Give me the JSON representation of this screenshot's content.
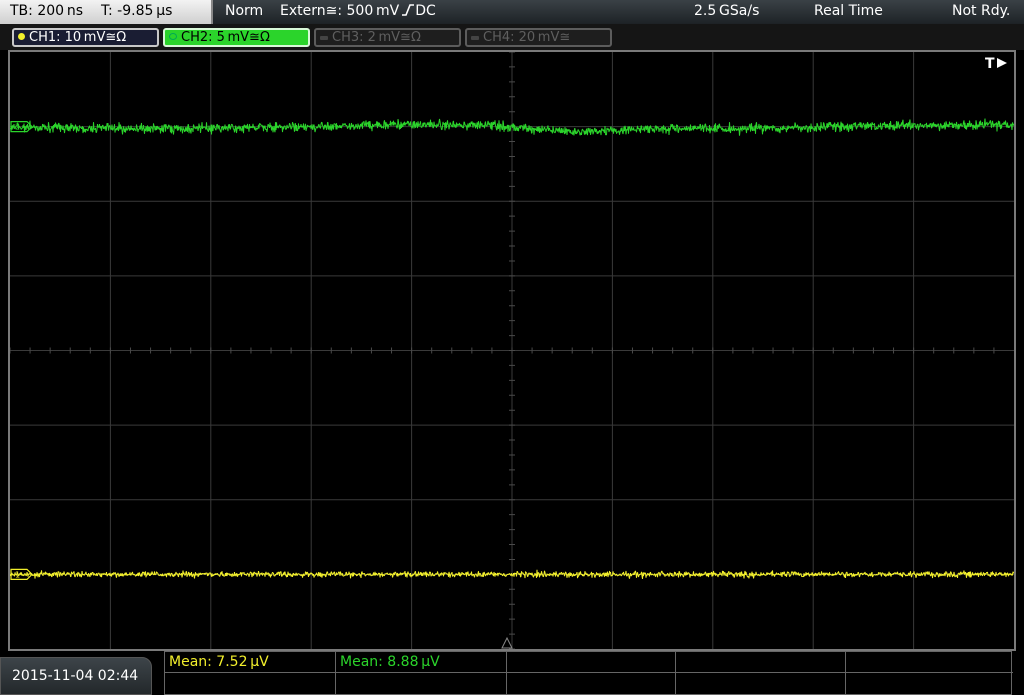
{
  "topbar": {
    "timebase": "TB: 200 ns",
    "trigger_time": "T: -9.85 µs",
    "acq_mode": "Norm",
    "trigger_source": "Extern≅: 500 mV",
    "trigger_coupling": "DC",
    "sample_rate": "2.5 GSa/s",
    "mode": "Real Time",
    "status": "Not Rdy."
  },
  "channels": [
    {
      "label": "CH1: 10 mV≅Ω",
      "color": "#f2ef2c",
      "state": "active"
    },
    {
      "label": "CH2: 5 mV≅Ω",
      "color": "#2bd42b",
      "state": "selected"
    },
    {
      "label": "CH3: 2 mV≅Ω",
      "color": "#5f5f5f",
      "state": "off"
    },
    {
      "label": "CH4: 20 mV≅",
      "color": "#5f5f5f",
      "state": "off"
    }
  ],
  "screen": {
    "trigger_marker": "T",
    "ch1_marker": "1",
    "ch2_marker": "2",
    "ch1_level_div": -3.0,
    "ch2_level_div": 3.0,
    "grid_divisions": {
      "x": 10,
      "y": 8
    },
    "trace_colors": {
      "ch1": "#f2ef2c",
      "ch2": "#2bd42b"
    }
  },
  "bottom": {
    "datetime": "2015-11-04 02:44",
    "measurements": [
      {
        "text": "Mean: 7.52 µV",
        "color": "#f2ef2c"
      },
      {
        "text": "Mean: 8.88 µV",
        "color": "#2bd42b"
      }
    ]
  }
}
